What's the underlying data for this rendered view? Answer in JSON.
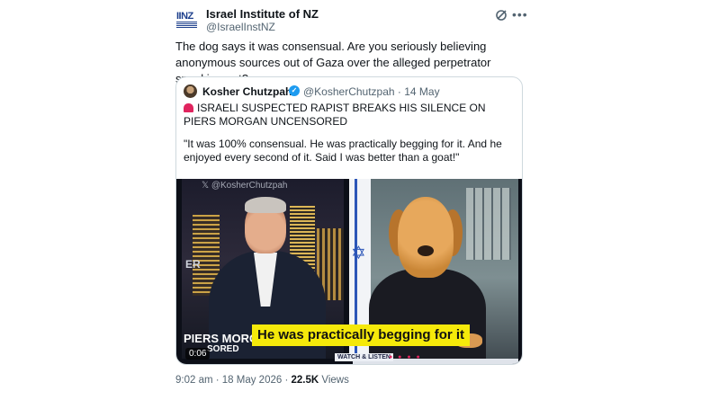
{
  "author": {
    "logo_text": "IINZ",
    "name": "Israel Institute of NZ",
    "handle": "@IsraelInstNZ"
  },
  "icons": {
    "grok": "grok-icon",
    "more": "more-icon",
    "verified": "verified-icon",
    "siren": "siren-icon"
  },
  "tweet_text": "The dog says it was consensual. Are you seriously believing anonymous sources out of Gaza over the alleged perpetrator speaking out?",
  "quote": {
    "name": "Kosher Chutzpah",
    "handle_date": "@KosherChutzpah · 14 May",
    "headline": "ISRAELI SUSPECTED RAPIST BREAKS HIS SILENCE ON PIERS MORGAN UNCENSORED",
    "quote_text": "\"It was 100% consensual. He was practically begging for it. And he enjoyed every second of it. Said I was better than a goat!\""
  },
  "video": {
    "watermark": "@KosherChutzpah",
    "studio_text": "ER",
    "subtitle": "He was practically begging for it",
    "show_title": "PIERS MORGAN",
    "show_sub": "SORED",
    "time": "0:06",
    "watch": "WATCH & LISTEN"
  },
  "meta": {
    "timestamp": "9:02 am · 18 May 2026 ·",
    "views_count": "22.5K",
    "views_label": "Views"
  }
}
